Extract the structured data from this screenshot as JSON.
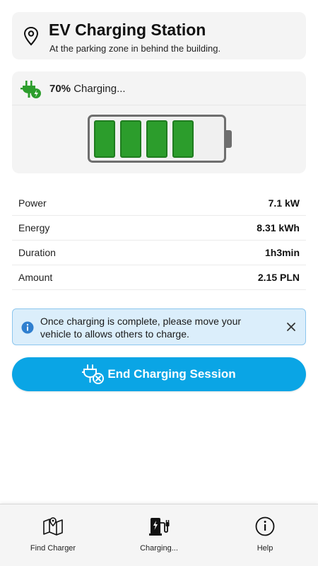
{
  "station": {
    "title": "EV Charging Station",
    "subtitle": "At the parking zone in behind the building.",
    "icon": "location-pin-icon"
  },
  "charging": {
    "percent_label": "70%",
    "status_label": "Charging...",
    "level_fraction": 0.7,
    "icon": "plug-charging-icon",
    "accent": "#2c9d2c"
  },
  "details": [
    {
      "label": "Power",
      "value": "7.1 kW"
    },
    {
      "label": "Energy",
      "value": "8.31 kWh"
    },
    {
      "label": "Duration",
      "value": "1h3min"
    },
    {
      "label": "Amount",
      "value": "2.15 PLN"
    }
  ],
  "alert": {
    "message": "Once charging is complete, please move your vehicle to allows others to charge.",
    "icon": "info-icon",
    "close_icon": "close-icon",
    "color": "#dbeefb"
  },
  "end_button": {
    "label": "End Charging Session",
    "icon": "unplug-icon",
    "color": "#0aa5e5"
  },
  "nav": {
    "find_label": "Find Charger",
    "charging_label": "Charging...",
    "help_label": "Help"
  }
}
